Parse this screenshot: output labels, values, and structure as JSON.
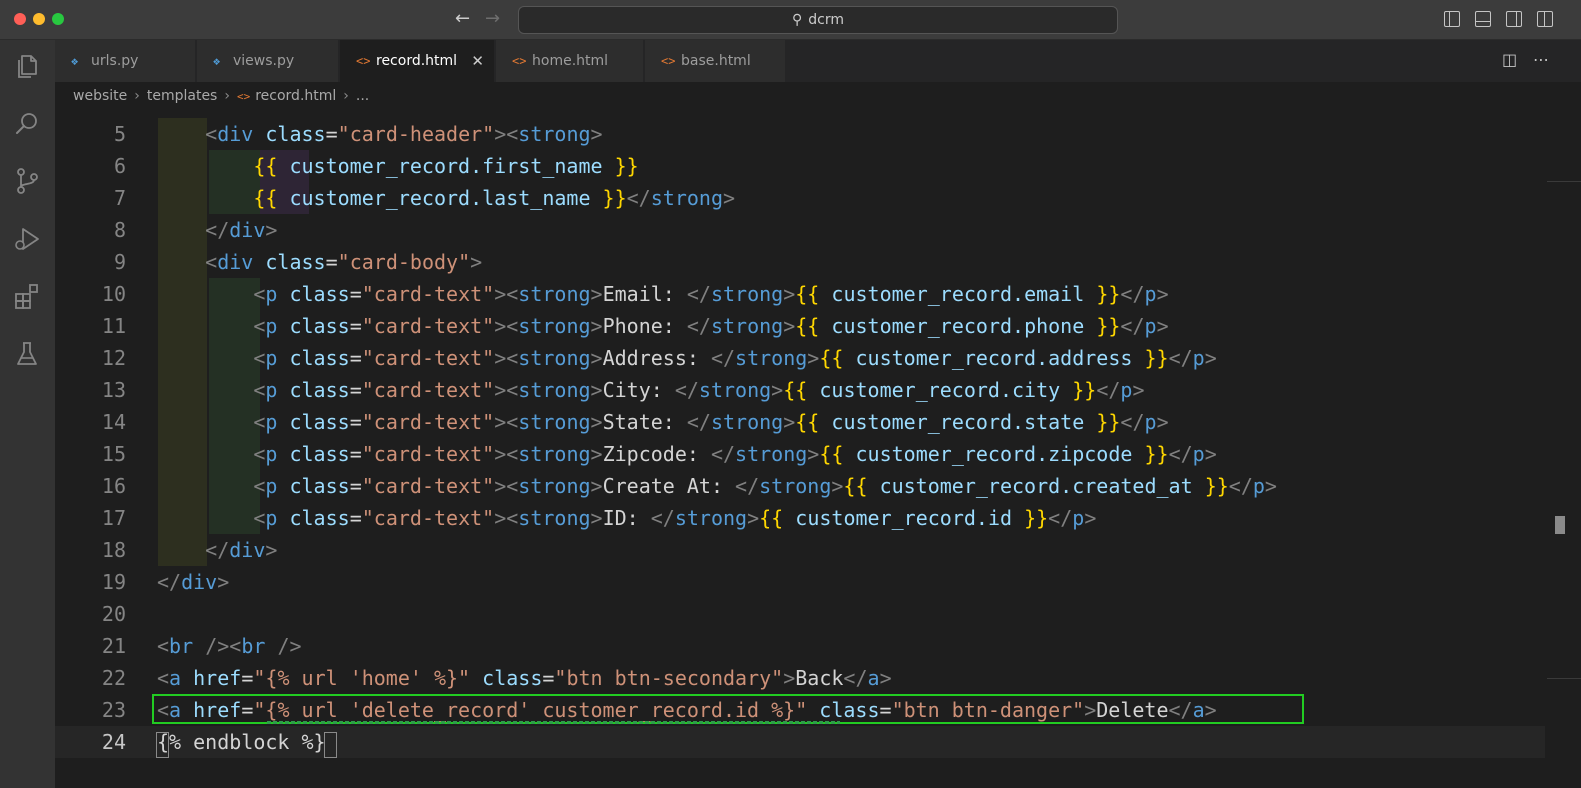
{
  "window": {
    "search_text": "dcrm"
  },
  "activity_bar": [
    {
      "name": "explorer-icon"
    },
    {
      "name": "search-icon"
    },
    {
      "name": "source-control-icon"
    },
    {
      "name": "run-debug-icon"
    },
    {
      "name": "extensions-icon"
    },
    {
      "name": "testing-icon"
    }
  ],
  "tabs": [
    {
      "label": "urls.py",
      "icon": "python-file-icon",
      "active": false
    },
    {
      "label": "views.py",
      "icon": "python-file-icon",
      "active": false
    },
    {
      "label": "record.html",
      "icon": "html-file-icon",
      "active": true
    },
    {
      "label": "home.html",
      "icon": "html-file-icon",
      "active": false
    },
    {
      "label": "base.html",
      "icon": "html-file-icon",
      "active": false
    }
  ],
  "breadcrumb": {
    "parts": [
      "website",
      "templates",
      "record.html",
      "..."
    ]
  },
  "editor": {
    "lines": [
      {
        "n": "5",
        "tokens": [
          [
            "i",
            "    "
          ],
          [
            "br",
            "<"
          ],
          [
            "tag",
            "div"
          ],
          [
            "t",
            " "
          ],
          [
            "attr",
            "class"
          ],
          [
            "t",
            "="
          ],
          [
            "str",
            "\"card-header\""
          ],
          [
            "br",
            ">"
          ],
          [
            "br",
            "<"
          ],
          [
            "tag",
            "strong"
          ],
          [
            "br",
            ">"
          ]
        ]
      },
      {
        "n": "6",
        "tokens": [
          [
            "i",
            "        "
          ],
          [
            "tpl",
            "{{"
          ],
          [
            "t",
            " "
          ],
          [
            "var",
            "customer_record.first_name"
          ],
          [
            "t",
            " "
          ],
          [
            "tpl",
            "}}"
          ]
        ]
      },
      {
        "n": "7",
        "tokens": [
          [
            "i",
            "        "
          ],
          [
            "tpl",
            "{{"
          ],
          [
            "t",
            " "
          ],
          [
            "var",
            "customer_record.last_name"
          ],
          [
            "t",
            " "
          ],
          [
            "tpl",
            "}}"
          ],
          [
            "br",
            "</"
          ],
          [
            "tag",
            "strong"
          ],
          [
            "br",
            ">"
          ]
        ]
      },
      {
        "n": "8",
        "tokens": [
          [
            "i",
            "    "
          ],
          [
            "br",
            "</"
          ],
          [
            "tag",
            "div"
          ],
          [
            "br",
            ">"
          ]
        ]
      },
      {
        "n": "9",
        "tokens": [
          [
            "i",
            "    "
          ],
          [
            "br",
            "<"
          ],
          [
            "tag",
            "div"
          ],
          [
            "t",
            " "
          ],
          [
            "attr",
            "class"
          ],
          [
            "t",
            "="
          ],
          [
            "str",
            "\"card-body\""
          ],
          [
            "br",
            ">"
          ]
        ]
      },
      {
        "n": "10",
        "tokens": [
          [
            "i",
            "        "
          ],
          [
            "br",
            "<"
          ],
          [
            "tag",
            "p"
          ],
          [
            "t",
            " "
          ],
          [
            "attr",
            "class"
          ],
          [
            "t",
            "="
          ],
          [
            "str",
            "\"card-text\""
          ],
          [
            "br",
            ">"
          ],
          [
            "br",
            "<"
          ],
          [
            "tag",
            "strong"
          ],
          [
            "br",
            ">"
          ],
          [
            "t",
            "Email: "
          ],
          [
            "br",
            "</"
          ],
          [
            "tag",
            "strong"
          ],
          [
            "br",
            ">"
          ],
          [
            "tpl",
            "{{"
          ],
          [
            "t",
            " "
          ],
          [
            "var",
            "customer_record.email"
          ],
          [
            "t",
            " "
          ],
          [
            "tpl",
            "}}"
          ],
          [
            "br",
            "</"
          ],
          [
            "tag",
            "p"
          ],
          [
            "br",
            ">"
          ]
        ]
      },
      {
        "n": "11",
        "tokens": [
          [
            "i",
            "        "
          ],
          [
            "br",
            "<"
          ],
          [
            "tag",
            "p"
          ],
          [
            "t",
            " "
          ],
          [
            "attr",
            "class"
          ],
          [
            "t",
            "="
          ],
          [
            "str",
            "\"card-text\""
          ],
          [
            "br",
            ">"
          ],
          [
            "br",
            "<"
          ],
          [
            "tag",
            "strong"
          ],
          [
            "br",
            ">"
          ],
          [
            "t",
            "Phone: "
          ],
          [
            "br",
            "</"
          ],
          [
            "tag",
            "strong"
          ],
          [
            "br",
            ">"
          ],
          [
            "tpl",
            "{{"
          ],
          [
            "t",
            " "
          ],
          [
            "var",
            "customer_record.phone"
          ],
          [
            "t",
            " "
          ],
          [
            "tpl",
            "}}"
          ],
          [
            "br",
            "</"
          ],
          [
            "tag",
            "p"
          ],
          [
            "br",
            ">"
          ]
        ]
      },
      {
        "n": "12",
        "tokens": [
          [
            "i",
            "        "
          ],
          [
            "br",
            "<"
          ],
          [
            "tag",
            "p"
          ],
          [
            "t",
            " "
          ],
          [
            "attr",
            "class"
          ],
          [
            "t",
            "="
          ],
          [
            "str",
            "\"card-text\""
          ],
          [
            "br",
            ">"
          ],
          [
            "br",
            "<"
          ],
          [
            "tag",
            "strong"
          ],
          [
            "br",
            ">"
          ],
          [
            "t",
            "Address: "
          ],
          [
            "br",
            "</"
          ],
          [
            "tag",
            "strong"
          ],
          [
            "br",
            ">"
          ],
          [
            "tpl",
            "{{"
          ],
          [
            "t",
            " "
          ],
          [
            "var",
            "customer_record.address"
          ],
          [
            "t",
            " "
          ],
          [
            "tpl",
            "}}"
          ],
          [
            "br",
            "</"
          ],
          [
            "tag",
            "p"
          ],
          [
            "br",
            ">"
          ]
        ]
      },
      {
        "n": "13",
        "tokens": [
          [
            "i",
            "        "
          ],
          [
            "br",
            "<"
          ],
          [
            "tag",
            "p"
          ],
          [
            "t",
            " "
          ],
          [
            "attr",
            "class"
          ],
          [
            "t",
            "="
          ],
          [
            "str",
            "\"card-text\""
          ],
          [
            "br",
            ">"
          ],
          [
            "br",
            "<"
          ],
          [
            "tag",
            "strong"
          ],
          [
            "br",
            ">"
          ],
          [
            "t",
            "City: "
          ],
          [
            "br",
            "</"
          ],
          [
            "tag",
            "strong"
          ],
          [
            "br",
            ">"
          ],
          [
            "tpl",
            "{{"
          ],
          [
            "t",
            " "
          ],
          [
            "var",
            "customer_record.city"
          ],
          [
            "t",
            " "
          ],
          [
            "tpl",
            "}}"
          ],
          [
            "br",
            "</"
          ],
          [
            "tag",
            "p"
          ],
          [
            "br",
            ">"
          ]
        ]
      },
      {
        "n": "14",
        "tokens": [
          [
            "i",
            "        "
          ],
          [
            "br",
            "<"
          ],
          [
            "tag",
            "p"
          ],
          [
            "t",
            " "
          ],
          [
            "attr",
            "class"
          ],
          [
            "t",
            "="
          ],
          [
            "str",
            "\"card-text\""
          ],
          [
            "br",
            ">"
          ],
          [
            "br",
            "<"
          ],
          [
            "tag",
            "strong"
          ],
          [
            "br",
            ">"
          ],
          [
            "t",
            "State: "
          ],
          [
            "br",
            "</"
          ],
          [
            "tag",
            "strong"
          ],
          [
            "br",
            ">"
          ],
          [
            "tpl",
            "{{"
          ],
          [
            "t",
            " "
          ],
          [
            "var",
            "customer_record.state"
          ],
          [
            "t",
            " "
          ],
          [
            "tpl",
            "}}"
          ],
          [
            "br",
            "</"
          ],
          [
            "tag",
            "p"
          ],
          [
            "br",
            ">"
          ]
        ]
      },
      {
        "n": "15",
        "tokens": [
          [
            "i",
            "        "
          ],
          [
            "br",
            "<"
          ],
          [
            "tag",
            "p"
          ],
          [
            "t",
            " "
          ],
          [
            "attr",
            "class"
          ],
          [
            "t",
            "="
          ],
          [
            "str",
            "\"card-text\""
          ],
          [
            "br",
            ">"
          ],
          [
            "br",
            "<"
          ],
          [
            "tag",
            "strong"
          ],
          [
            "br",
            ">"
          ],
          [
            "t",
            "Zipcode: "
          ],
          [
            "br",
            "</"
          ],
          [
            "tag",
            "strong"
          ],
          [
            "br",
            ">"
          ],
          [
            "tpl",
            "{{"
          ],
          [
            "t",
            " "
          ],
          [
            "var",
            "customer_record.zipcode"
          ],
          [
            "t",
            " "
          ],
          [
            "tpl",
            "}}"
          ],
          [
            "br",
            "</"
          ],
          [
            "tag",
            "p"
          ],
          [
            "br",
            ">"
          ]
        ]
      },
      {
        "n": "16",
        "tokens": [
          [
            "i",
            "        "
          ],
          [
            "br",
            "<"
          ],
          [
            "tag",
            "p"
          ],
          [
            "t",
            " "
          ],
          [
            "attr",
            "class"
          ],
          [
            "t",
            "="
          ],
          [
            "str",
            "\"card-text\""
          ],
          [
            "br",
            ">"
          ],
          [
            "br",
            "<"
          ],
          [
            "tag",
            "strong"
          ],
          [
            "br",
            ">"
          ],
          [
            "t",
            "Create At: "
          ],
          [
            "br",
            "</"
          ],
          [
            "tag",
            "strong"
          ],
          [
            "br",
            ">"
          ],
          [
            "tpl",
            "{{"
          ],
          [
            "t",
            " "
          ],
          [
            "var",
            "customer_record.created_at"
          ],
          [
            "t",
            " "
          ],
          [
            "tpl",
            "}}"
          ],
          [
            "br",
            "</"
          ],
          [
            "tag",
            "p"
          ],
          [
            "br",
            ">"
          ]
        ]
      },
      {
        "n": "17",
        "tokens": [
          [
            "i",
            "        "
          ],
          [
            "br",
            "<"
          ],
          [
            "tag",
            "p"
          ],
          [
            "t",
            " "
          ],
          [
            "attr",
            "class"
          ],
          [
            "t",
            "="
          ],
          [
            "str",
            "\"card-text\""
          ],
          [
            "br",
            ">"
          ],
          [
            "br",
            "<"
          ],
          [
            "tag",
            "strong"
          ],
          [
            "br",
            ">"
          ],
          [
            "t",
            "ID: "
          ],
          [
            "br",
            "</"
          ],
          [
            "tag",
            "strong"
          ],
          [
            "br",
            ">"
          ],
          [
            "tpl",
            "{{"
          ],
          [
            "t",
            " "
          ],
          [
            "var",
            "customer_record.id"
          ],
          [
            "t",
            " "
          ],
          [
            "tpl",
            "}}"
          ],
          [
            "br",
            "</"
          ],
          [
            "tag",
            "p"
          ],
          [
            "br",
            ">"
          ]
        ]
      },
      {
        "n": "18",
        "tokens": [
          [
            "i",
            "    "
          ],
          [
            "br",
            "</"
          ],
          [
            "tag",
            "div"
          ],
          [
            "br",
            ">"
          ]
        ]
      },
      {
        "n": "19",
        "tokens": [
          [
            "br",
            "</"
          ],
          [
            "tag",
            "div"
          ],
          [
            "br",
            ">"
          ]
        ]
      },
      {
        "n": "20",
        "tokens": []
      },
      {
        "n": "21",
        "tokens": [
          [
            "br",
            "<"
          ],
          [
            "tag",
            "br"
          ],
          [
            "t",
            " "
          ],
          [
            "br",
            "/>"
          ],
          [
            "br",
            "<"
          ],
          [
            "tag",
            "br"
          ],
          [
            "t",
            " "
          ],
          [
            "br",
            "/>"
          ]
        ]
      },
      {
        "n": "22",
        "tokens": [
          [
            "br",
            "<"
          ],
          [
            "tag",
            "a"
          ],
          [
            "t",
            " "
          ],
          [
            "attr",
            "href"
          ],
          [
            "t",
            "="
          ],
          [
            "str",
            "\"{% url 'home' %}\""
          ],
          [
            "t",
            " "
          ],
          [
            "attr",
            "class"
          ],
          [
            "t",
            "="
          ],
          [
            "str",
            "\"btn btn-secondary\""
          ],
          [
            "br",
            ">"
          ],
          [
            "t",
            "Back"
          ],
          [
            "br",
            "</"
          ],
          [
            "tag",
            "a"
          ],
          [
            "br",
            ">"
          ]
        ]
      },
      {
        "n": "23",
        "tokens": [
          [
            "br",
            "<"
          ],
          [
            "tag",
            "a"
          ],
          [
            "t",
            " "
          ],
          [
            "attr",
            "href"
          ],
          [
            "t",
            "="
          ],
          [
            "str",
            "\"{% url 'delete_record' customer_record.id %}\""
          ],
          [
            "t",
            " "
          ],
          [
            "attr",
            "class"
          ],
          [
            "t",
            "="
          ],
          [
            "str",
            "\"btn btn-danger\""
          ],
          [
            "br",
            ">"
          ],
          [
            "t",
            "Delete"
          ],
          [
            "br",
            "</"
          ],
          [
            "tag",
            "a"
          ],
          [
            "br",
            ">"
          ]
        ]
      },
      {
        "n": "24",
        "tokens": [
          [
            "t",
            "{% endblock %}"
          ]
        ]
      }
    ]
  }
}
